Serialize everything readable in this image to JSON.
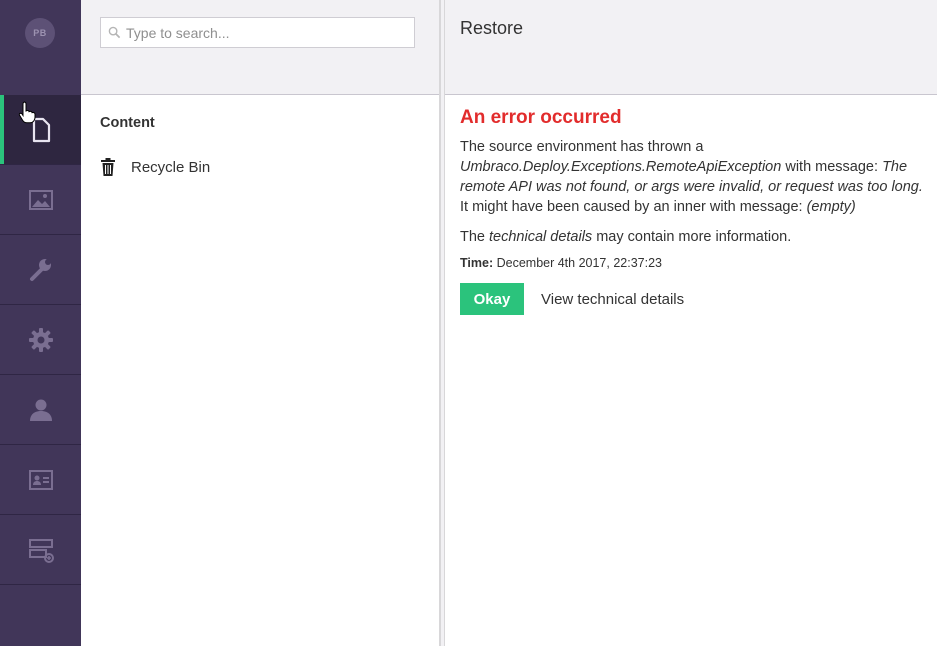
{
  "user": {
    "initials": "PB"
  },
  "sections": [
    {
      "name": "content",
      "icon": "document-icon",
      "active": true
    },
    {
      "name": "media",
      "icon": "image-icon",
      "active": false
    },
    {
      "name": "settings",
      "icon": "wrench-icon",
      "active": false
    },
    {
      "name": "developer",
      "icon": "gear-icon",
      "active": false
    },
    {
      "name": "users",
      "icon": "user-icon",
      "active": false
    },
    {
      "name": "members",
      "icon": "id-card-icon",
      "active": false
    },
    {
      "name": "forms",
      "icon": "add-list-icon",
      "active": false
    }
  ],
  "tree": {
    "search_placeholder": "Type to search...",
    "title": "Content",
    "items": [
      {
        "label": "Recycle Bin",
        "icon": "trash-icon"
      }
    ]
  },
  "main": {
    "title": "Restore",
    "error": {
      "title": "An error occurred",
      "line1_a": "The source environment has thrown a ",
      "exception": "Umbraco.Deploy.Exceptions.RemoteApiException",
      "line1_b": " with message: ",
      "message": "The remote API was not found, or args were invalid, or request was too long.",
      "line1_c": " It might have been caused by an inner with message: ",
      "inner": "(empty)",
      "line2_a": "The ",
      "line2_em": "technical details",
      "line2_b": " may contain more information.",
      "time_label": "Time:",
      "time_value": " December 4th 2017, 22:37:23"
    },
    "buttons": {
      "okay": "Okay",
      "details": "View technical details"
    }
  },
  "colors": {
    "rail": "#413659",
    "accent": "#2bc37c",
    "error": "#e22c2c"
  }
}
